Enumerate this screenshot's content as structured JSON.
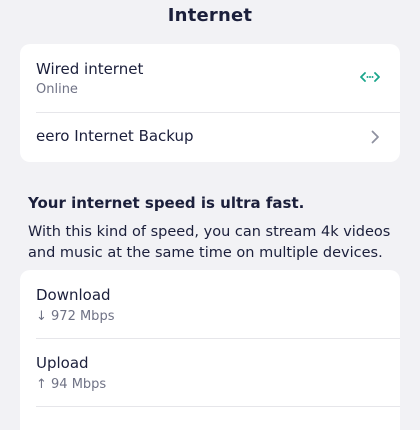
{
  "header": {
    "title": "Internet"
  },
  "connection": {
    "wired": {
      "label": "Wired internet",
      "status": "Online",
      "icon": "wired-connection-icon",
      "icon_color": "#1aa68c"
    },
    "backup": {
      "label": "eero Internet Backup",
      "icon": "chevron-right-icon"
    }
  },
  "speed_info": {
    "heading": "Your internet speed is ultra fast.",
    "description": "With this kind of speed, you can stream 4k videos and music at the same time on multiple devices."
  },
  "speeds": {
    "download": {
      "label": "Download",
      "value": "↓ 972 Mbps",
      "icon": "arrow-down-icon"
    },
    "upload": {
      "label": "Upload",
      "value": "↑ 94 Mbps",
      "icon": "arrow-up-icon"
    }
  }
}
